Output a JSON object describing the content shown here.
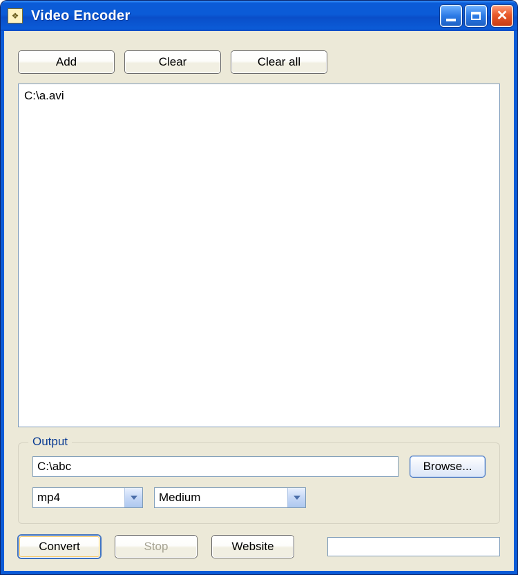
{
  "window": {
    "title": "Video Encoder"
  },
  "toolbar": {
    "add_label": "Add",
    "clear_label": "Clear",
    "clear_all_label": "Clear all"
  },
  "file_list": {
    "items": [
      "C:\\a.avi"
    ]
  },
  "output": {
    "legend": "Output",
    "path_value": "C:\\abc",
    "browse_label": "Browse...",
    "format_selected": "mp4",
    "quality_selected": "Medium"
  },
  "actions": {
    "convert_label": "Convert",
    "stop_label": "Stop",
    "website_label": "Website",
    "stop_enabled": false
  },
  "progress": {
    "value": 0
  }
}
